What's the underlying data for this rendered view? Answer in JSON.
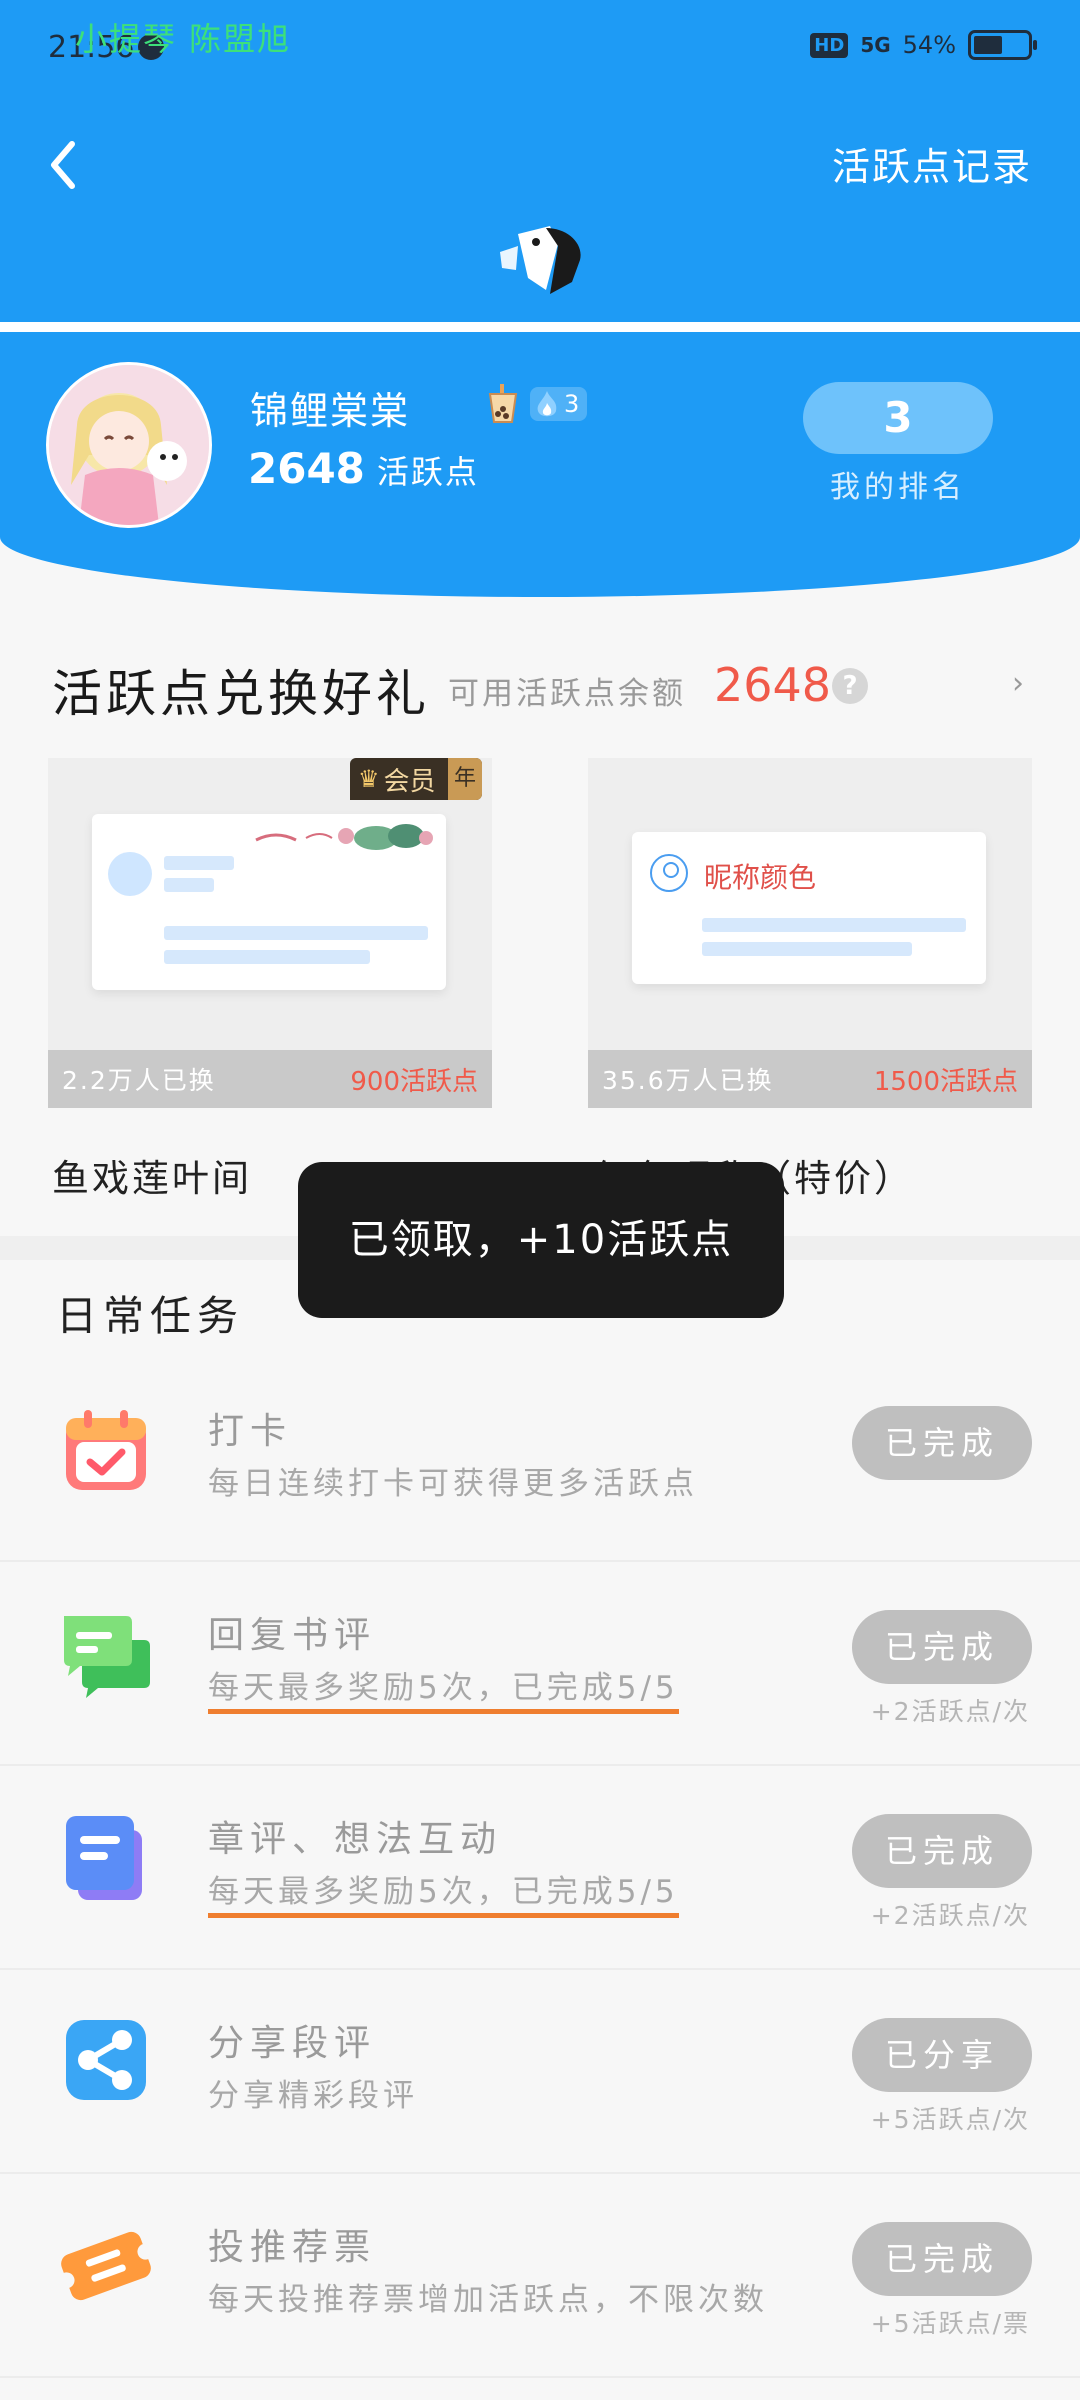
{
  "status_bar": {
    "time": "21:56",
    "overlay_text": "小提琴  陈盟旭",
    "hd": "HD",
    "signal": "5G",
    "battery": "54%"
  },
  "header": {
    "record_label": "活跃点记录"
  },
  "profile": {
    "name": "锦鲤棠棠",
    "badge_level": "3",
    "points": "2648",
    "points_unit": "活跃点",
    "rank": "3",
    "rank_label": "我的排名"
  },
  "exchange": {
    "title": "活跃点兑换好礼",
    "balance_label": "可用活跃点余额",
    "balance": "2648",
    "help": "?",
    "more": "›",
    "items": [
      {
        "name": "鱼戏莲叶间",
        "count": "2.2万人已换",
        "price": "900活跃点",
        "vip": "会员",
        "vip_year": "年"
      },
      {
        "name": "红色昵称（特价）",
        "count": "35.6万人已换",
        "price": "1500活跃点",
        "preview_text": "昵称颜色"
      }
    ]
  },
  "toast": "已领取，+10活跃点",
  "daily": {
    "title": "日常任务",
    "tasks": [
      {
        "title": "打卡",
        "desc": "每日连续打卡可获得更多活跃点",
        "button": "已完成",
        "reward": ""
      },
      {
        "title": "回复书评",
        "desc": "每天最多奖励5次，已完成5/5",
        "button": "已完成",
        "reward": "+2活跃点/次"
      },
      {
        "title": "章评、想法互动",
        "desc": "每天最多奖励5次，已完成5/5",
        "button": "已完成",
        "reward": "+2活跃点/次"
      },
      {
        "title": "分享段评",
        "desc": "分享精彩段评",
        "button": "已分享",
        "reward": "+5活跃点/次"
      },
      {
        "title": "投推荐票",
        "desc": "每天投推荐票增加活跃点，不限次数",
        "button": "已完成",
        "reward": "+5活跃点/票"
      }
    ]
  },
  "colors": {
    "brand_blue": "#1e9bf5",
    "accent_red": "#f05a4a",
    "underline_orange": "#ef7e2f"
  }
}
